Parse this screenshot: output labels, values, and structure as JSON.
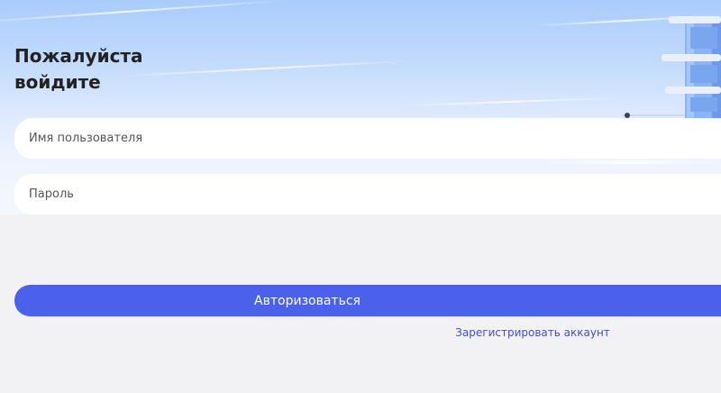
{
  "login": {
    "title_line1": "Пожалуйста",
    "title_line2": "войдите",
    "username_placeholder": "Имя пользователя",
    "password_placeholder": "Пароль",
    "submit_label": "Авторизоваться",
    "register_link": "Зарегистрировать аккаунт"
  },
  "colors": {
    "accent": "#4a62eb",
    "link": "#4250c4",
    "sky_top": "#a9ccfb",
    "background": "#f2f2f4"
  },
  "icons": {
    "hero_illustration": "control-tower-illustration"
  }
}
